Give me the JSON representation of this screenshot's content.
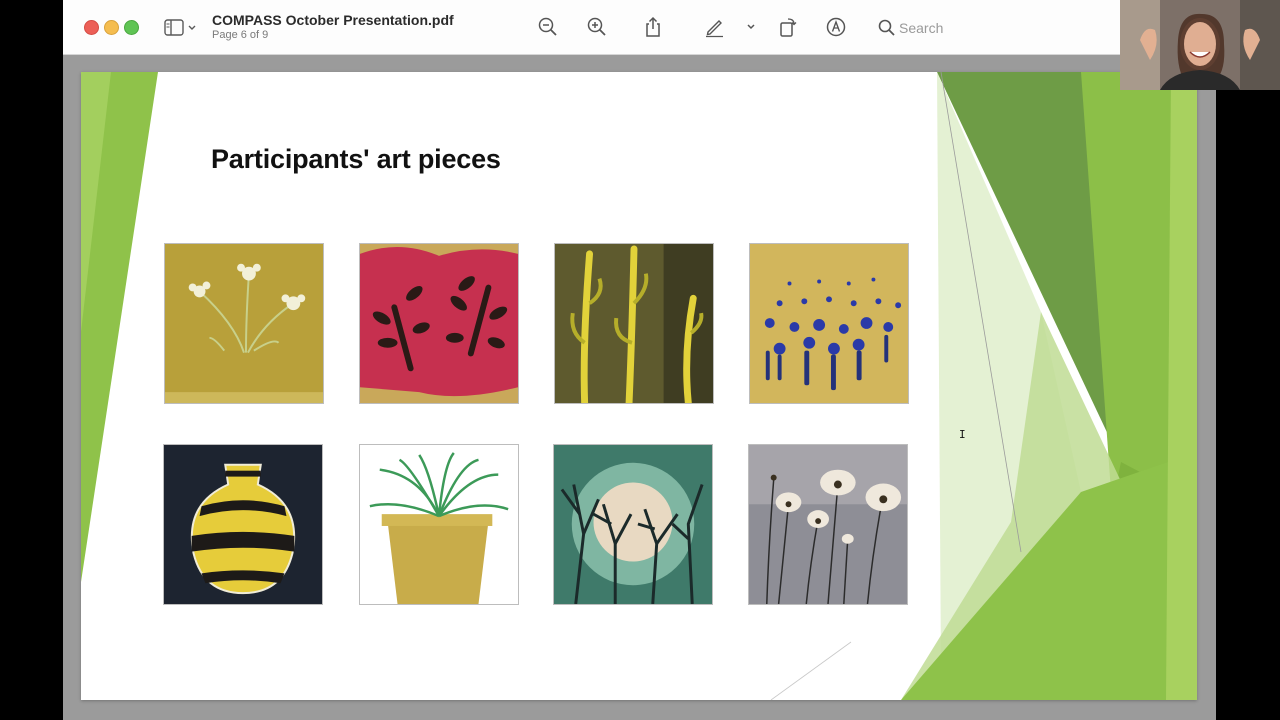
{
  "window": {
    "document_title": "COMPASS October Presentation.pdf",
    "page_indicator": "Page 6 of 9",
    "search_placeholder": "Search"
  },
  "toolbar": {
    "icons": [
      "sidebar-icon",
      "zoom-out-icon",
      "zoom-in-icon",
      "share-icon",
      "markup-pen-icon",
      "chevron-down-icon",
      "rotate-icon",
      "annotate-icon",
      "search-icon"
    ]
  },
  "slide": {
    "title": "Participants' art pieces",
    "accent_colors": [
      "#8bc34a",
      "#6d9a3a",
      "#a6d05a"
    ],
    "artworks": [
      {
        "subject": "white flowers on ochre"
      },
      {
        "subject": "black leaves on pink"
      },
      {
        "subject": "yellow stalks"
      },
      {
        "subject": "blue flowers field"
      },
      {
        "subject": "striped vase"
      },
      {
        "subject": "potted plant"
      },
      {
        "subject": "trees with moon"
      },
      {
        "subject": "white poppies on grey"
      }
    ]
  }
}
